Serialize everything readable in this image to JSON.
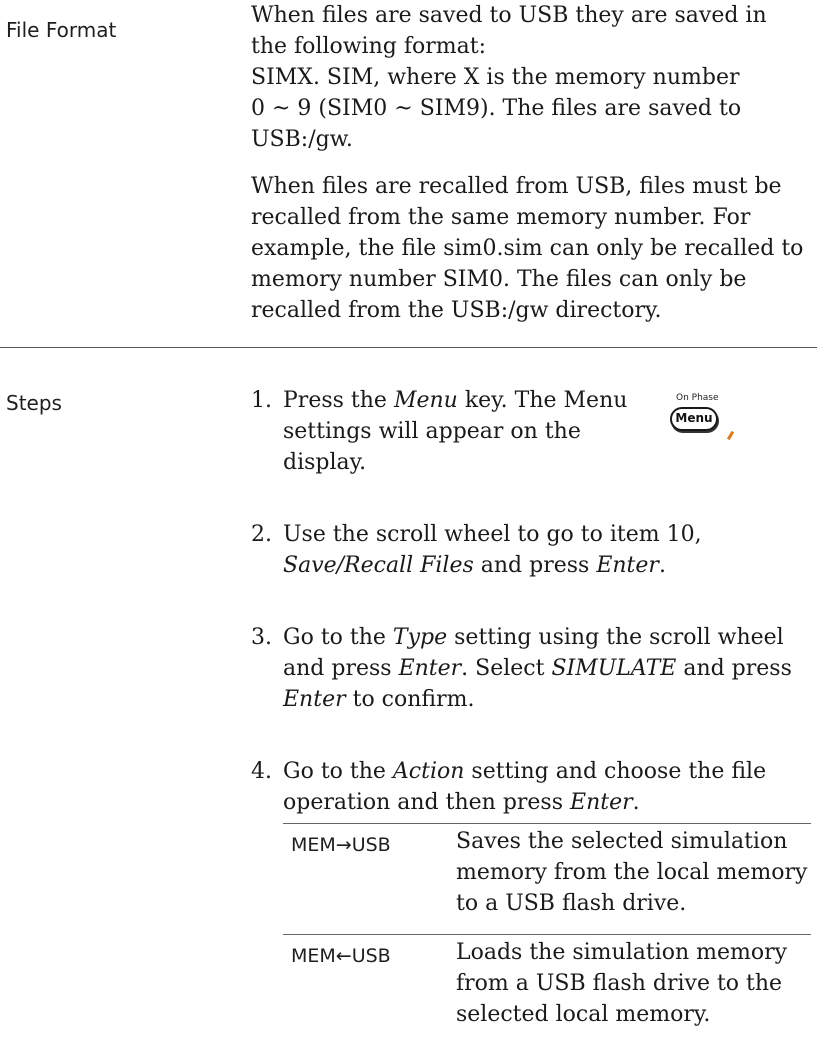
{
  "file_format": {
    "label": "File Format",
    "para1_lines": [
      "When files are saved to USB they are saved in",
      "the following format:",
      "SIMX. SIM, where X is the memory number",
      "0 ~ 9 (SIM0 ~ SIM9). The files are saved to",
      "USB:/gw."
    ],
    "para2_lines": [
      "When files are recalled from USB, files must be",
      "recalled from the same memory number. For",
      "example, the file sim0.sim can only be recalled to",
      "memory number SIM0. The files can only be",
      "recalled from the USB:/gw directory."
    ]
  },
  "steps": {
    "label": "Steps",
    "step1": {
      "num": "1.",
      "l1_a": "Press the ",
      "l1_key": "Menu",
      "l1_b": " key. The Menu",
      "l2": "settings will appear on the",
      "l3": "display."
    },
    "step2": {
      "num": "2.",
      "l1": "Use the scroll wheel to go to item 10,",
      "l2_a": "Save/Recall Files",
      "l2_b": " and press ",
      "l2_c": "Enter",
      "l2_d": "."
    },
    "step3": {
      "num": "3.",
      "l1_a": "Go to the ",
      "l1_b": "Type",
      "l1_c": " setting using the scroll wheel",
      "l2_a": "and press ",
      "l2_b": "Enter",
      "l2_c": ". Select ",
      "l2_d": "SIMULATE",
      "l2_e": " and press",
      "l3_a": "Enter",
      "l3_b": " to confirm."
    },
    "step4": {
      "num": "4.",
      "l1_a": "Go to the ",
      "l1_b": "Action",
      "l1_c": " setting and choose the file",
      "l2_a": "operation and then press ",
      "l2_b": "Enter",
      "l2_c": "."
    }
  },
  "menu_key": {
    "caption": "On Phase",
    "label": "Menu"
  },
  "actions": [
    {
      "key": "MEM→USB",
      "lines": [
        "Saves the selected simulation",
        "memory from the local memory",
        "to a USB flash drive."
      ]
    },
    {
      "key": "MEM←USB",
      "lines": [
        "Loads the simulation memory",
        "from a USB flash drive to the",
        "selected local memory."
      ]
    }
  ]
}
